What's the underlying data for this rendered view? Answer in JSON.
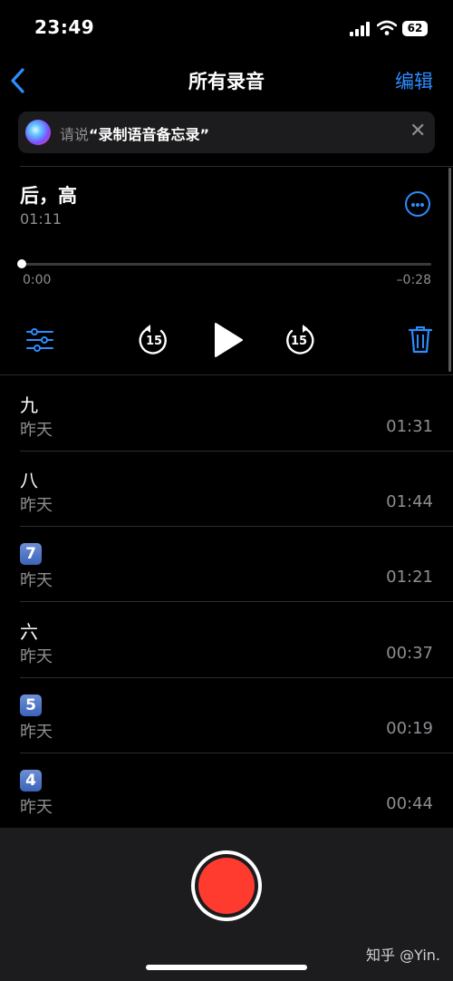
{
  "status_bar": {
    "time": "23:49",
    "battery": "62"
  },
  "nav": {
    "title": "所有录音",
    "edit": "编辑"
  },
  "siri": {
    "prefix": "请说",
    "quote": "“录制语音备忘录”"
  },
  "current": {
    "title": "后，高",
    "duration": "01:11",
    "elapsed": "0:00",
    "remaining": "–0:28",
    "skip_back": "15",
    "skip_forward": "15"
  },
  "recordings": [
    {
      "title": "九",
      "date": "昨天",
      "duration": "01:31"
    },
    {
      "title": "八",
      "date": "昨天",
      "duration": "01:44"
    },
    {
      "title": "7",
      "date": "昨天",
      "duration": "01:21"
    },
    {
      "title": "六",
      "date": "昨天",
      "duration": "00:37"
    },
    {
      "title": "5",
      "date": "昨天",
      "duration": "00:19"
    },
    {
      "title": "4",
      "date": "昨天",
      "duration": "00:44"
    }
  ],
  "watermark": "知乎 @Yin."
}
